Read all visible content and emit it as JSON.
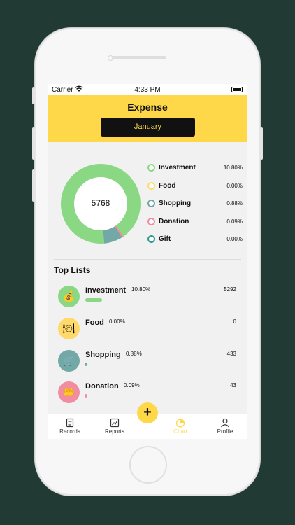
{
  "status_bar": {
    "carrier": "Carrier",
    "time": "4:33 PM"
  },
  "header": {
    "title": "Expense",
    "month": "January"
  },
  "summary": {
    "total": "5768"
  },
  "colors": {
    "brand": "#ffd84a",
    "investment": "#8bd884",
    "food": "#ffd96a",
    "shopping": "#72a9a6",
    "donation": "#f28ca0",
    "gift": "#2f9a8e"
  },
  "chart_data": {
    "type": "pie",
    "center_label": "5768",
    "categories": [
      "Investment",
      "Food",
      "Shopping",
      "Donation",
      "Gift"
    ],
    "values": [
      5292,
      0,
      433,
      43,
      0
    ],
    "percent_labels": [
      "10.80%",
      "0.00%",
      "0.88%",
      "0.09%",
      "0.00%"
    ]
  },
  "legend": [
    {
      "name": "Investment",
      "percent": "10.80%",
      "color_key": "investment"
    },
    {
      "name": "Food",
      "percent": "0.00%",
      "color_key": "food"
    },
    {
      "name": "Shopping",
      "percent": "0.88%",
      "color_key": "shopping"
    },
    {
      "name": "Donation",
      "percent": "0.09%",
      "color_key": "donation"
    },
    {
      "name": "Gift",
      "percent": "0.00%",
      "color_key": "gift"
    }
  ],
  "top_lists": {
    "title": "Top Lists",
    "items": [
      {
        "name": "Investment",
        "percent": "10.80%",
        "value": "5292",
        "bar_fraction": 0.9,
        "icon": "money-bag-icon"
      },
      {
        "name": "Food",
        "percent": "0.00%",
        "value": "0",
        "bar_fraction": 0.0,
        "icon": "plate-utensils-icon"
      },
      {
        "name": "Shopping",
        "percent": "0.88%",
        "value": "433",
        "bar_fraction": 0.075,
        "icon": "shopping-cart-icon"
      },
      {
        "name": "Donation",
        "percent": "0.09%",
        "value": "43",
        "bar_fraction": 0.008,
        "icon": "donation-hand-icon"
      }
    ]
  },
  "tabs": [
    {
      "label": "Records",
      "icon": "records-icon"
    },
    {
      "label": "Reports",
      "icon": "reports-icon"
    },
    {
      "label": "Chart",
      "icon": "chart-icon"
    },
    {
      "label": "Profile",
      "icon": "profile-icon"
    }
  ],
  "fab": {
    "label": "+"
  }
}
